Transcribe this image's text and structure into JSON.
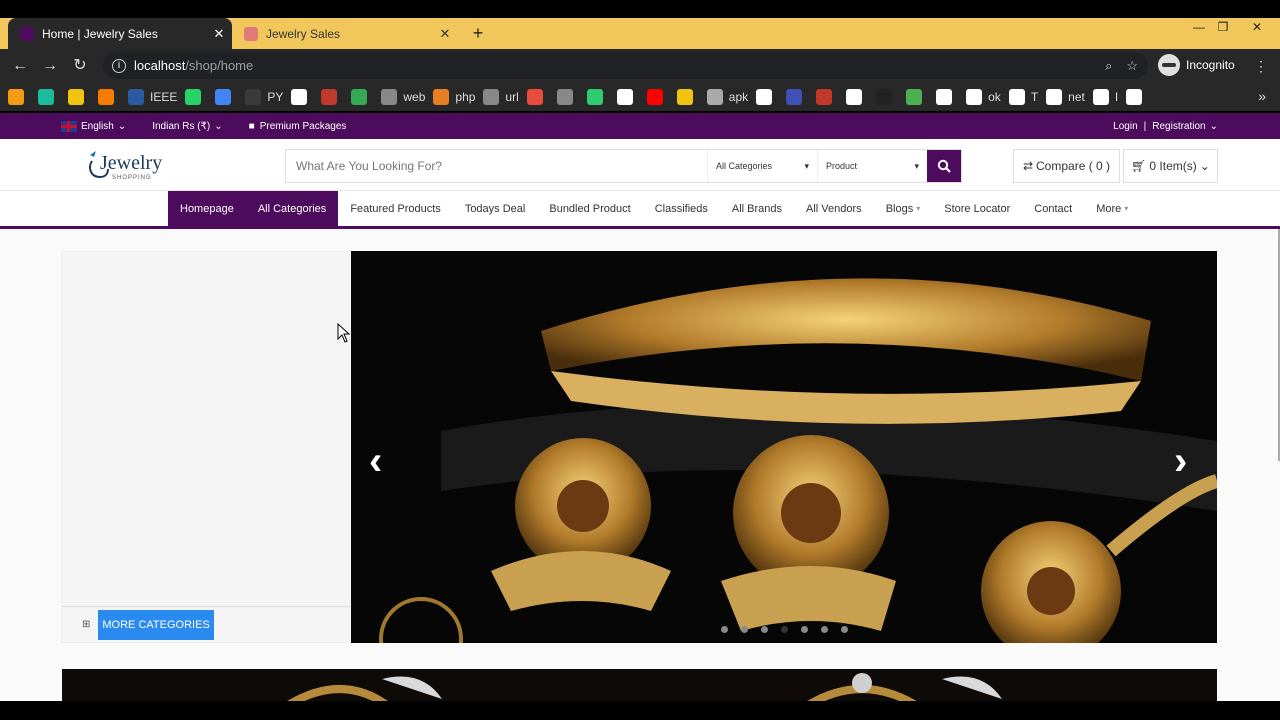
{
  "browser": {
    "tabs": [
      {
        "title": "Home | Jewelry Sales",
        "active": true
      },
      {
        "title": "Jewelry Sales",
        "active": false
      }
    ],
    "new_tab": "+",
    "url_host": "localhost",
    "url_path": "/shop/home",
    "incognito_label": "Incognito",
    "bookmarks": [
      {
        "label": "",
        "icon": "orange-arrow-icon",
        "color": "#f39c12"
      },
      {
        "label": "",
        "icon": "v-icon",
        "color": "#1abc9c"
      },
      {
        "label": "",
        "icon": "grade-icon",
        "color": "#f1c40f"
      },
      {
        "label": "",
        "icon": "analytics-icon",
        "color": "#f57c00"
      },
      {
        "label": "IEEE",
        "icon": "ieee-icon",
        "color": "#2c5aa0"
      },
      {
        "label": "",
        "icon": "whatsapp-icon",
        "color": "#25d366"
      },
      {
        "label": "",
        "icon": "ads-icon",
        "color": "#4285f4"
      },
      {
        "label": "PY",
        "icon": "py-icon",
        "color": "#3a3a3a"
      },
      {
        "label": "",
        "icon": "google-icon",
        "color": "#ffffff"
      },
      {
        "label": "",
        "icon": "mail-icon",
        "color": "#c0392b"
      },
      {
        "label": "",
        "icon": "drive-icon",
        "color": "#34a853"
      },
      {
        "label": "web",
        "icon": "web-icon",
        "color": "#888888"
      },
      {
        "label": "php",
        "icon": "php-icon",
        "color": "#e67e22"
      },
      {
        "label": "url",
        "icon": "url-icon",
        "color": "#888888"
      },
      {
        "label": "",
        "icon": "shop-icon",
        "color": "#e74c3c"
      },
      {
        "label": "",
        "icon": "box-icon",
        "color": "#888888"
      },
      {
        "label": "",
        "icon": "circle-icon",
        "color": "#2ecc71"
      },
      {
        "label": "",
        "icon": "tag-icon",
        "color": "#ffffff"
      },
      {
        "label": "",
        "icon": "youtube-icon",
        "color": "#ff0000"
      },
      {
        "label": "",
        "icon": "p-icon",
        "color": "#f1c40f"
      },
      {
        "label": "apk",
        "icon": "apk-icon",
        "color": "#aaaaaa"
      },
      {
        "label": "",
        "icon": "google-icon",
        "color": "#ffffff"
      },
      {
        "label": "",
        "icon": "image-icon",
        "color": "#3f51b5"
      },
      {
        "label": "",
        "icon": "red-icon",
        "color": "#c0392b"
      },
      {
        "label": "",
        "icon": "globe-icon",
        "color": "#ffffff"
      },
      {
        "label": "",
        "icon": "cl-icon",
        "color": "#222222"
      },
      {
        "label": "",
        "icon": "android-icon",
        "color": "#4caf50"
      },
      {
        "label": "",
        "icon": "y-icon",
        "color": "#ffffff"
      },
      {
        "label": "ok",
        "icon": "google-icon",
        "color": "#ffffff"
      },
      {
        "label": "T",
        "icon": "google-icon",
        "color": "#ffffff"
      },
      {
        "label": "net",
        "icon": "google-icon",
        "color": "#ffffff"
      },
      {
        "label": "I",
        "icon": "google-icon",
        "color": "#ffffff"
      },
      {
        "label": "",
        "icon": "google-icon",
        "color": "#ffffff"
      }
    ],
    "bookmarks_overflow": "»"
  },
  "site": {
    "brand_color": "#4d0b5d",
    "topbar": {
      "language": "English",
      "currency": "Indian Rs (₹)",
      "premium": "Premium Packages",
      "login": "Login",
      "separator": "|",
      "registration": "Registration"
    },
    "logo_text": "Jewelry",
    "logo_sub": "SHOPPING",
    "search": {
      "placeholder": "What Are You Looking For?",
      "category": "All Categories",
      "type": "Product"
    },
    "compare": "Compare ( 0 )",
    "cart": "0 Item(s)",
    "nav": [
      {
        "label": "Homepage",
        "active": true
      },
      {
        "label": "All Categories",
        "active": true
      },
      {
        "label": "Featured Products"
      },
      {
        "label": "Todays Deal"
      },
      {
        "label": "Bundled Product"
      },
      {
        "label": "Classifieds"
      },
      {
        "label": "All Brands"
      },
      {
        "label": "All Vendors"
      },
      {
        "label": "Blogs",
        "dropdown": true
      },
      {
        "label": "Store Locator"
      },
      {
        "label": "Contact"
      },
      {
        "label": "More",
        "dropdown": true
      }
    ],
    "more_categories": "MORE CATEGORIES",
    "slider": {
      "slide_count": 7,
      "active_index": 3
    }
  }
}
